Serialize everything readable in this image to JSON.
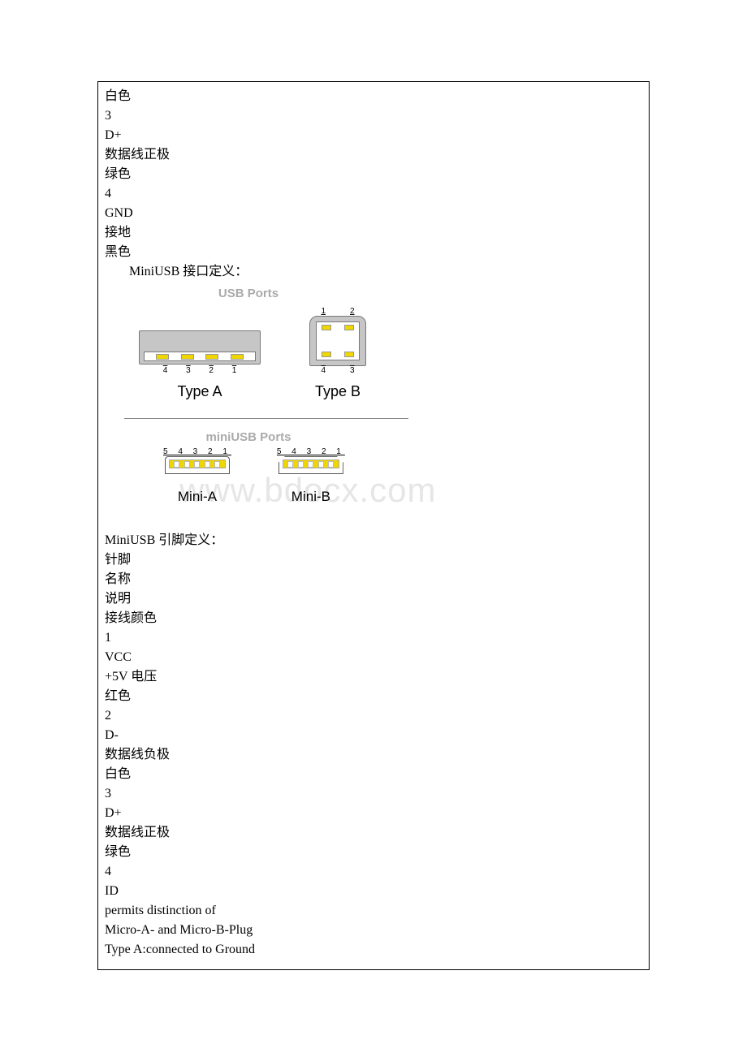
{
  "pre_lines": [
    "白色",
    "3",
    "D+",
    "数据线正极",
    "绿色",
    "4",
    "GND",
    "接地",
    "黑色"
  ],
  "section_title": "MiniUSB 接口定义：",
  "usb_ports_title": "USB Ports",
  "type_a": {
    "label": "Type A",
    "pins": [
      "4",
      "3",
      "2",
      "1"
    ]
  },
  "type_b": {
    "label": "Type B",
    "top": [
      "1",
      "2"
    ],
    "bottom": [
      "4",
      "3"
    ]
  },
  "miniusb_ports_title": "miniUSB Ports",
  "mini_labels": "5 4 3 2 1",
  "mini_a_label": "Mini-A",
  "mini_b_label": "Mini-B",
  "watermark": "www.bdocx.com",
  "post_heading": "MiniUSB 引脚定义：",
  "post_lines": [
    "针脚",
    "名称",
    "说明",
    "接线颜色",
    "1",
    "VCC",
    "+5V 电压",
    "红色",
    "2",
    "D-",
    "数据线负极",
    "白色",
    "3",
    "D+",
    "数据线正极",
    "绿色",
    "4",
    "ID",
    "permits distinction of",
    "Micro-A- and Micro-B-Plug",
    "Type A:connected to Ground"
  ]
}
